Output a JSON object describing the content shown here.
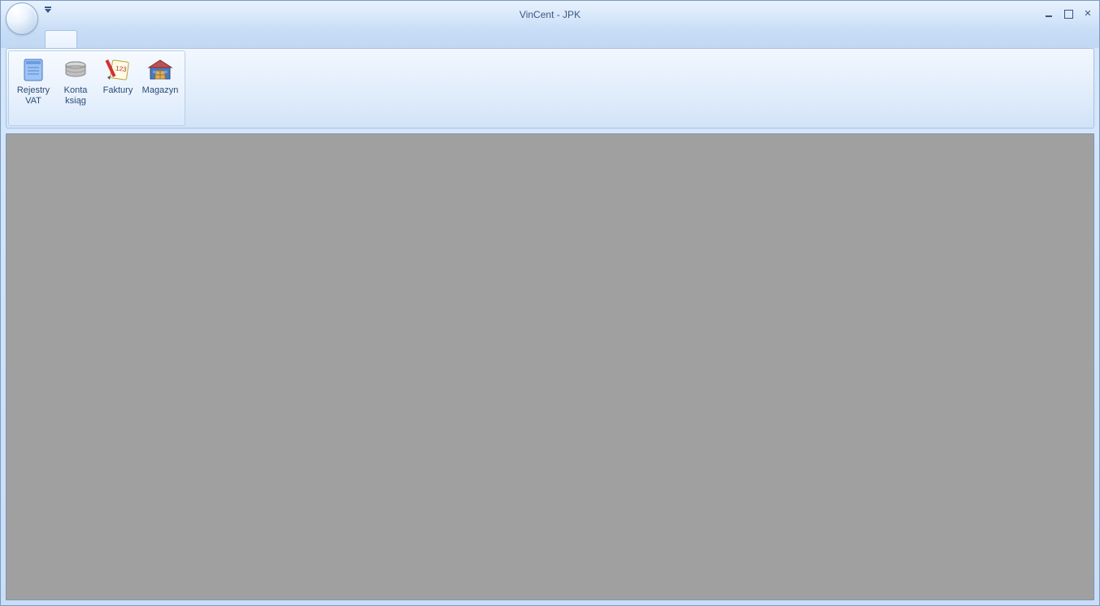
{
  "window": {
    "title": "VinCent - JPK"
  },
  "ribbon": {
    "buttons": [
      {
        "label": "Rejestry\nVAT",
        "icon": "notepad-icon"
      },
      {
        "label": "Konta\nksiąg",
        "icon": "books-icon"
      },
      {
        "label": "Faktury",
        "icon": "invoice-icon"
      },
      {
        "label": "Magazyn",
        "icon": "warehouse-icon"
      }
    ]
  }
}
